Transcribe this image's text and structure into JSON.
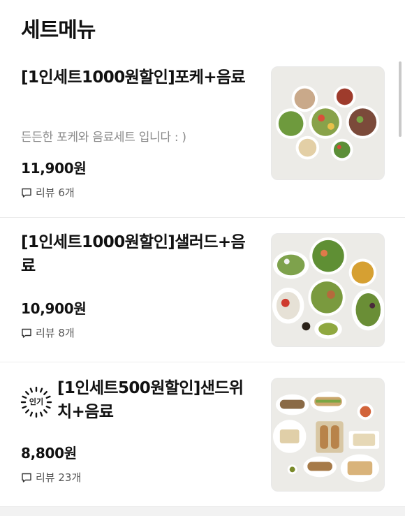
{
  "section": {
    "title": "세트메뉴"
  },
  "items": [
    {
      "name": "[1인세트1000원할인]포케+음료",
      "description": "든든한 포케와 음료세트 입니다 : )",
      "price": "11,900원",
      "review": "리뷰 6개",
      "image_icon": "poke-bowls-image"
    },
    {
      "name": "[1인세트1000원할인]샐러드+음료",
      "price": "10,900원",
      "review": "리뷰 8개",
      "image_icon": "salad-plates-image"
    },
    {
      "badge": "인기",
      "name": "[1인세트500원할인]샌드위치+음료",
      "price": "8,800원",
      "review": "리뷰 23개",
      "image_icon": "sandwich-plates-image"
    }
  ]
}
